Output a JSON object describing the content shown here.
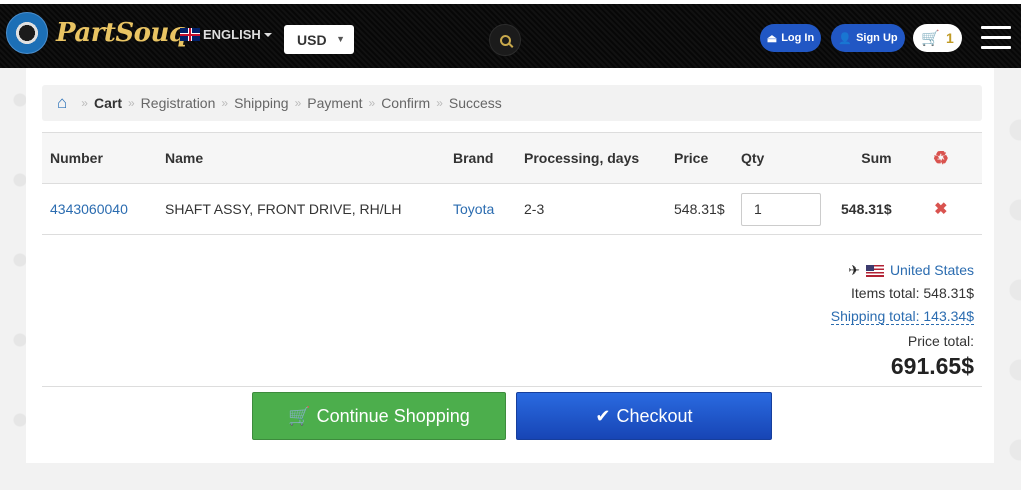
{
  "header": {
    "logo_badge_text": "PARTSOUQ",
    "logo_text": "PartSouq",
    "language": "ENGLISH",
    "currency": "USD",
    "login_label": "Log In",
    "signup_label": "Sign Up",
    "cart_count": "1"
  },
  "breadcrumb": {
    "items": [
      "Cart",
      "Registration",
      "Shipping",
      "Payment",
      "Confirm",
      "Success"
    ]
  },
  "table": {
    "headers": [
      "Number",
      "Name",
      "Brand",
      "Processing, days",
      "Price",
      "Qty",
      "Sum"
    ],
    "rows": [
      {
        "number": "4343060040",
        "name": "SHAFT ASSY, FRONT DRIVE, RH/LH",
        "brand": "Toyota",
        "processing": "2-3",
        "price": "548.31$",
        "qty": "1",
        "sum": "548.31$"
      }
    ]
  },
  "summary": {
    "country": "United States",
    "items_total": "Items total: 548.31$",
    "shipping_total": "Shipping total: 143.34$",
    "price_total_label": "Price total:",
    "price_total_value": "691.65$"
  },
  "actions": {
    "continue_label": "Continue Shopping",
    "checkout_label": "Checkout"
  },
  "colors": {
    "link": "#2b6cb0",
    "continue_bg": "#4cae4c",
    "checkout_bg": "#1e55c7",
    "brand_gold": "#e9c463",
    "delete_red": "#d9534f"
  }
}
